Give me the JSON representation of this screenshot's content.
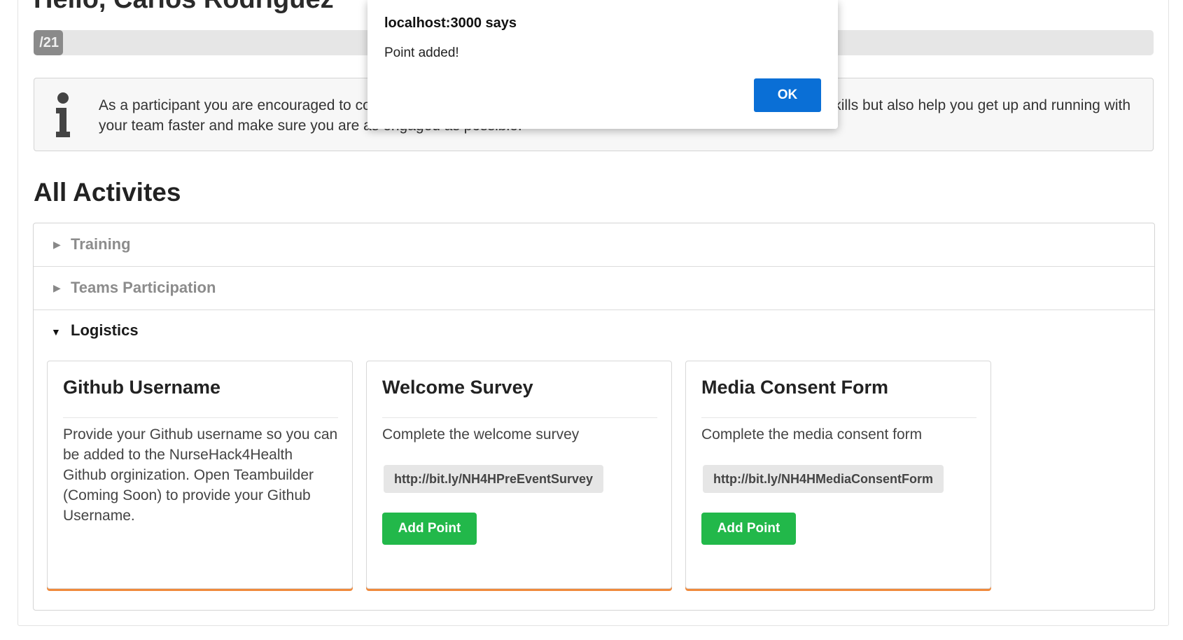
{
  "header": {
    "greeting": "Hello, Carlos Rodriguez",
    "progress_label": "/21"
  },
  "info": {
    "text": "As a participant you are encouraged to complete these activities. They not only will teach you new and valuable skills but also help you get up and running with your team faster and make sure you are as engaged as possible."
  },
  "activities": {
    "title": "All Activites",
    "sections": [
      {
        "label": "Training",
        "expanded": false
      },
      {
        "label": "Teams Participation",
        "expanded": false
      },
      {
        "label": "Logistics",
        "expanded": true
      }
    ],
    "cards": [
      {
        "title": "Github Username",
        "description": "Provide your Github username so you can be added to the NurseHack4Health Github orginization. Open Teambuilder (Coming Soon) to provide your Github Username.",
        "link": "",
        "button": ""
      },
      {
        "title": "Welcome Survey",
        "description": "Complete the welcome survey",
        "link": "http://bit.ly/NH4HPreEventSurvey",
        "button": "Add Point"
      },
      {
        "title": "Media Consent Form",
        "description": "Complete the media consent form",
        "link": "http://bit.ly/NH4HMediaConsentForm",
        "button": "Add Point"
      }
    ]
  },
  "dialog": {
    "title": "localhost:3000 says",
    "message": "Point added!",
    "ok_label": "OK"
  },
  "colors": {
    "button_green": "#22b84a",
    "card_accent": "#f08a3c",
    "dialog_ok": "#0a6fd6"
  }
}
